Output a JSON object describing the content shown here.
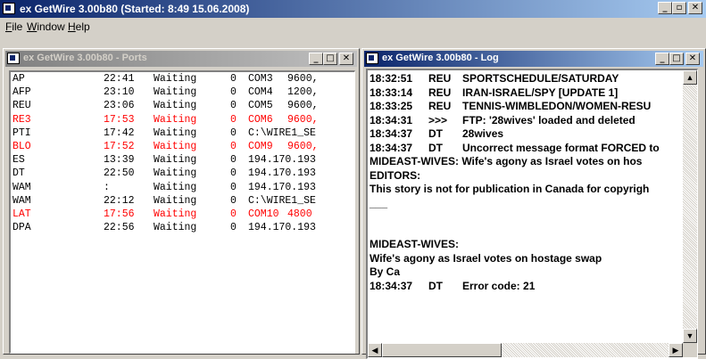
{
  "app": {
    "title": "ex GetWire 3.00b80   (Started: 8:49 15.06.2008)",
    "caption_buttons": [
      "minimize-icon",
      "restore-icon",
      "close-icon"
    ]
  },
  "menu": [
    "File",
    "Window",
    "Help"
  ],
  "ports_window": {
    "title": "ex GetWire 3.00b80  - Ports",
    "rows": [
      {
        "name": "AP",
        "time": "22:41",
        "state": "Waiting",
        "num": "0",
        "port": "COM3",
        "param": "9600,",
        "color": "#000000"
      },
      {
        "name": "AFP",
        "time": "23:10",
        "state": "Waiting",
        "num": "0",
        "port": "COM4",
        "param": "1200,",
        "color": "#000000"
      },
      {
        "name": "REU",
        "time": "23:06",
        "state": "Waiting",
        "num": "0",
        "port": "COM5",
        "param": "9600,",
        "color": "#000000"
      },
      {
        "name": "RE3",
        "time": "17:53",
        "state": "Waiting",
        "num": "0",
        "port": "COM6",
        "param": "9600,",
        "color": "#ff0000"
      },
      {
        "name": "PTI",
        "time": "17:42",
        "state": "Waiting",
        "num": "0",
        "port": "C:\\WIRE1_SE",
        "param": "",
        "color": "#000000"
      },
      {
        "name": "BLO",
        "time": "17:52",
        "state": "Waiting",
        "num": "0",
        "port": "COM9",
        "param": "9600,",
        "color": "#ff0000"
      },
      {
        "name": "ES",
        "time": "13:39",
        "state": "Waiting",
        "num": "0",
        "port": "194.170.193",
        "param": "",
        "color": "#000000"
      },
      {
        "name": "DT",
        "time": "22:50",
        "state": "Waiting",
        "num": "0",
        "port": "194.170.193",
        "param": "",
        "color": "#000000"
      },
      {
        "name": "WAM",
        "time": ":",
        "state": "Waiting",
        "num": "0",
        "port": "194.170.193",
        "param": "",
        "color": "#000000"
      },
      {
        "name": "WAM",
        "time": "22:12",
        "state": "Waiting",
        "num": "0",
        "port": "C:\\WIRE1_SE",
        "param": "",
        "color": "#000000"
      },
      {
        "name": "LAT",
        "time": "17:56",
        "state": "Waiting",
        "num": "0",
        "port": "COM10",
        "param": "4800",
        "color": "#ff0000"
      },
      {
        "name": "DPA",
        "time": "22:56",
        "state": "Waiting",
        "num": "0",
        "port": "194.170.193",
        "param": "",
        "color": "#000000"
      }
    ]
  },
  "log_window": {
    "title": "ex GetWire 3.00b80  - Log",
    "lines": [
      {
        "time": "18:32:51",
        "src": "REU",
        "msg": "SPORTSCHEDULE/SATURDAY"
      },
      {
        "time": "18:33:14",
        "src": "REU",
        "msg": "IRAN-ISRAEL/SPY [UPDATE 1]"
      },
      {
        "time": "18:33:25",
        "src": "REU",
        "msg": "TENNIS-WIMBLEDON/WOMEN-RESU"
      },
      {
        "time": "18:34:31",
        "src": ">>>",
        "msg": "FTP: '28wives' loaded and deleted"
      },
      {
        "time": "18:34:37",
        "src": "DT",
        "msg": "28wives"
      },
      {
        "time": "18:34:37",
        "src": "DT",
        "msg": "Uncorrect message format FORCED to"
      },
      {
        "time": "",
        "src": "",
        "msg": "MIDEAST-WIVES: Wife's agony as Israel votes on hos"
      },
      {
        "time": "",
        "src": "",
        "msg": "EDITORS:"
      },
      {
        "time": "",
        "src": "",
        "msg": "This story is not for publication in Canada for copyrigh"
      },
      {
        "time": "",
        "src": "",
        "msg": "___"
      },
      {
        "time": "",
        "src": "",
        "msg": ""
      },
      {
        "time": "",
        "src": "",
        "msg": ""
      },
      {
        "time": "",
        "src": "",
        "msg": "MIDEAST-WIVES:"
      },
      {
        "time": "",
        "src": "",
        "msg": "Wife's agony as Israel votes on hostage swap"
      },
      {
        "time": "",
        "src": "",
        "msg": " By Ca"
      },
      {
        "time": "18:34:37",
        "src": "DT",
        "msg": "Error code: 21"
      }
    ]
  },
  "colors": {
    "title_active": "#0a246a",
    "title_inactive": "#808080",
    "alert": "#ff0000",
    "face": "#d4d0c8"
  }
}
